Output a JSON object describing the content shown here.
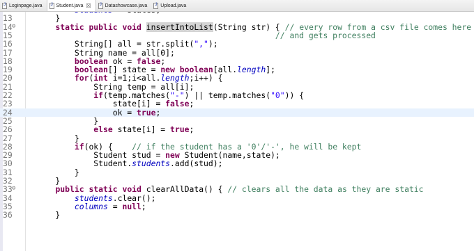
{
  "tabs": [
    {
      "label": "Loginpage.java",
      "active": false
    },
    {
      "label": "Student.java",
      "active": true,
      "close": "☒"
    },
    {
      "label": "Datashowcase.java",
      "active": false
    },
    {
      "label": "Upload.java",
      "active": false
    }
  ],
  "highlighted_line": "24",
  "editor_lines": [
    {
      "num": "",
      "fold": "",
      "tokens": [
        {
          "t": "        ",
          "c": "pl"
        },
        {
          "t": "students",
          "c": "fi"
        },
        {
          "t": " = ",
          "c": "pl"
        },
        {
          "t": "states",
          "c": "pl"
        },
        {
          "t": ";",
          "c": "pl"
        }
      ]
    },
    {
      "num": "13",
      "fold": "",
      "tokens": [
        {
          "t": "    }",
          "c": "pl"
        }
      ]
    },
    {
      "num": "14",
      "fold": "⊖",
      "tokens": [
        {
          "t": "    ",
          "c": "pl"
        },
        {
          "t": "static",
          "c": "kw"
        },
        {
          "t": " ",
          "c": "pl"
        },
        {
          "t": "public",
          "c": "kw"
        },
        {
          "t": " ",
          "c": "pl"
        },
        {
          "t": "void",
          "c": "kw"
        },
        {
          "t": " ",
          "c": "pl"
        },
        {
          "t": "insertIntoList",
          "c": "mb"
        },
        {
          "t": "(String str) { ",
          "c": "pl"
        },
        {
          "t": "// every row from a csv file comes here as a raw",
          "c": "cm"
        }
      ]
    },
    {
      "num": "15",
      "fold": "",
      "tokens": [
        {
          "t": "                                                  ",
          "c": "pl"
        },
        {
          "t": "// and gets processed",
          "c": "cm"
        }
      ]
    },
    {
      "num": "16",
      "fold": "",
      "tokens": [
        {
          "t": "        String[] all = str.split(",
          "c": "pl"
        },
        {
          "t": "\",\"",
          "c": "st"
        },
        {
          "t": ");",
          "c": "pl"
        }
      ]
    },
    {
      "num": "17",
      "fold": "",
      "tokens": [
        {
          "t": "        String name = all[0];",
          "c": "pl"
        }
      ]
    },
    {
      "num": "18",
      "fold": "",
      "tokens": [
        {
          "t": "        ",
          "c": "pl"
        },
        {
          "t": "boolean",
          "c": "kw"
        },
        {
          "t": " ok = ",
          "c": "pl"
        },
        {
          "t": "false",
          "c": "kw"
        },
        {
          "t": ";",
          "c": "pl"
        }
      ]
    },
    {
      "num": "19",
      "fold": "",
      "tokens": [
        {
          "t": "        ",
          "c": "pl"
        },
        {
          "t": "boolean",
          "c": "kw"
        },
        {
          "t": "[] state = ",
          "c": "pl"
        },
        {
          "t": "new",
          "c": "kw"
        },
        {
          "t": " ",
          "c": "pl"
        },
        {
          "t": "boolean",
          "c": "kw"
        },
        {
          "t": "[all.",
          "c": "pl"
        },
        {
          "t": "length",
          "c": "fi"
        },
        {
          "t": "];",
          "c": "pl"
        }
      ]
    },
    {
      "num": "20",
      "fold": "",
      "tokens": [
        {
          "t": "        ",
          "c": "pl"
        },
        {
          "t": "for",
          "c": "kw"
        },
        {
          "t": "(",
          "c": "pl"
        },
        {
          "t": "int",
          "c": "kw"
        },
        {
          "t": " i=1;i<all.",
          "c": "pl"
        },
        {
          "t": "length",
          "c": "fi"
        },
        {
          "t": ";i++) {",
          "c": "pl"
        }
      ]
    },
    {
      "num": "21",
      "fold": "",
      "tokens": [
        {
          "t": "            String temp = all[i];",
          "c": "pl"
        }
      ]
    },
    {
      "num": "22",
      "fold": "",
      "tokens": [
        {
          "t": "            ",
          "c": "pl"
        },
        {
          "t": "if",
          "c": "kw"
        },
        {
          "t": "(temp.matches(",
          "c": "pl"
        },
        {
          "t": "\"-\"",
          "c": "st"
        },
        {
          "t": ") || temp.matches(",
          "c": "pl"
        },
        {
          "t": "\"0\"",
          "c": "st"
        },
        {
          "t": ")) {",
          "c": "pl"
        }
      ]
    },
    {
      "num": "23",
      "fold": "",
      "tokens": [
        {
          "t": "                state[i] = ",
          "c": "pl"
        },
        {
          "t": "false",
          "c": "kw"
        },
        {
          "t": ";",
          "c": "pl"
        }
      ]
    },
    {
      "num": "24",
      "fold": "",
      "tokens": [
        {
          "t": "                ok = ",
          "c": "pl"
        },
        {
          "t": "true",
          "c": "kw"
        },
        {
          "t": ";",
          "c": "pl"
        }
      ]
    },
    {
      "num": "25",
      "fold": "",
      "tokens": [
        {
          "t": "            }",
          "c": "pl"
        }
      ]
    },
    {
      "num": "26",
      "fold": "",
      "tokens": [
        {
          "t": "            ",
          "c": "pl"
        },
        {
          "t": "else",
          "c": "kw"
        },
        {
          "t": " state[i] = ",
          "c": "pl"
        },
        {
          "t": "true",
          "c": "kw"
        },
        {
          "t": ";",
          "c": "pl"
        }
      ]
    },
    {
      "num": "27",
      "fold": "",
      "tokens": [
        {
          "t": "        }",
          "c": "pl"
        }
      ]
    },
    {
      "num": "28",
      "fold": "",
      "tokens": [
        {
          "t": "        ",
          "c": "pl"
        },
        {
          "t": "if",
          "c": "kw"
        },
        {
          "t": "(ok) {    ",
          "c": "pl"
        },
        {
          "t": "// if the student has a '0'/'-', he will be kept",
          "c": "cm"
        }
      ]
    },
    {
      "num": "29",
      "fold": "",
      "tokens": [
        {
          "t": "            Student stud = ",
          "c": "pl"
        },
        {
          "t": "new",
          "c": "kw"
        },
        {
          "t": " Student(name,state);",
          "c": "pl"
        }
      ]
    },
    {
      "num": "30",
      "fold": "",
      "tokens": [
        {
          "t": "            Student.",
          "c": "pl"
        },
        {
          "t": "students",
          "c": "fi"
        },
        {
          "t": ".add(stud);",
          "c": "pl"
        }
      ]
    },
    {
      "num": "31",
      "fold": "",
      "tokens": [
        {
          "t": "        }",
          "c": "pl"
        }
      ]
    },
    {
      "num": "32",
      "fold": "",
      "tokens": [
        {
          "t": "    }",
          "c": "pl"
        }
      ]
    },
    {
      "num": "33",
      "fold": "⊖",
      "tokens": [
        {
          "t": "    ",
          "c": "pl"
        },
        {
          "t": "public",
          "c": "kw"
        },
        {
          "t": " ",
          "c": "pl"
        },
        {
          "t": "static",
          "c": "kw"
        },
        {
          "t": " ",
          "c": "pl"
        },
        {
          "t": "void",
          "c": "kw"
        },
        {
          "t": " clearAllData() { ",
          "c": "pl"
        },
        {
          "t": "// clears all the data as they are static",
          "c": "cm"
        }
      ]
    },
    {
      "num": "34",
      "fold": "",
      "tokens": [
        {
          "t": "        ",
          "c": "pl"
        },
        {
          "t": "students",
          "c": "fi"
        },
        {
          "t": ".clear();",
          "c": "pl"
        }
      ]
    },
    {
      "num": "35",
      "fold": "",
      "tokens": [
        {
          "t": "        ",
          "c": "pl"
        },
        {
          "t": "columns",
          "c": "fi"
        },
        {
          "t": " = ",
          "c": "pl"
        },
        {
          "t": "null",
          "c": "kw"
        },
        {
          "t": ";",
          "c": "pl"
        }
      ]
    },
    {
      "num": "36",
      "fold": "",
      "tokens": [
        {
          "t": "    }",
          "c": "pl"
        }
      ]
    }
  ]
}
